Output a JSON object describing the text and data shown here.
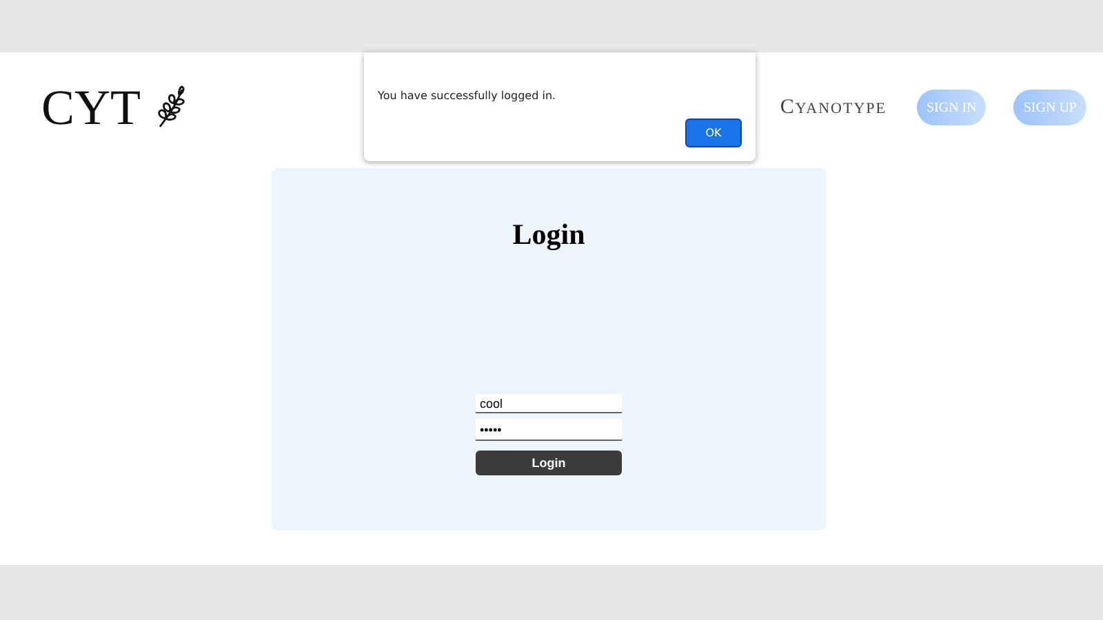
{
  "header": {
    "logo": "CYT",
    "brand": "Cyanotype",
    "buttons": [
      "SIGN IN",
      "SIGN UP"
    ]
  },
  "dialog": {
    "message": "You have successfully logged in.",
    "button": "OK"
  },
  "login": {
    "title": "Login",
    "username": "cool",
    "password": "•••••",
    "button": "Login"
  }
}
